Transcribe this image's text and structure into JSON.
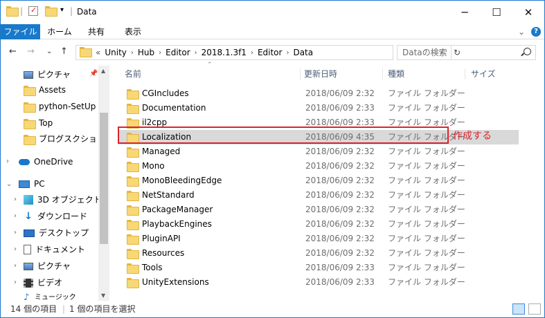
{
  "window": {
    "title": "Data",
    "controls": {
      "minimize": "─",
      "maximize": "☐",
      "close": "✕"
    }
  },
  "ribbon": {
    "tabs": [
      "ファイル",
      "ホーム",
      "共有",
      "表示"
    ],
    "expand_glyph": "⌄",
    "help_glyph": "?"
  },
  "nav_buttons": {
    "back": "←",
    "forward": "→",
    "recent": "⌄",
    "up": "↑"
  },
  "address": {
    "overflow": "«",
    "breadcrumbs": [
      "Unity",
      "Hub",
      "Editor",
      "2018.1.3f1",
      "Editor",
      "Data"
    ],
    "separator": "›",
    "dropdown": "⌄",
    "refresh": "↻"
  },
  "search": {
    "placeholder": "Dataの検索"
  },
  "navpane": {
    "quick_access": [
      "ピクチャ",
      "Assets",
      "python-SetUp",
      "Top",
      "ブログスクショ"
    ],
    "onedrive": "OneDrive",
    "pc": "PC",
    "pc_items": [
      "3D オブジェクト",
      "ダウンロード",
      "デスクトップ",
      "ドキュメント",
      "ピクチャ",
      "ビデオ",
      "ミュージック"
    ],
    "pin": "📌"
  },
  "columns": {
    "name": "名前",
    "date": "更新日時",
    "type": "種類",
    "size": "サイズ"
  },
  "files": [
    {
      "name": "CGIncludes",
      "date": "2018/06/09 2:32",
      "type": "ファイル フォルダー"
    },
    {
      "name": "Documentation",
      "date": "2018/06/09 2:33",
      "type": "ファイル フォルダー"
    },
    {
      "name": "il2cpp",
      "date": "2018/06/09 2:33",
      "type": "ファイル フォルダー"
    },
    {
      "name": "Localization",
      "date": "2018/06/09 4:35",
      "type": "ファイル フォルダー"
    },
    {
      "name": "Managed",
      "date": "2018/06/09 2:32",
      "type": "ファイル フォルダー"
    },
    {
      "name": "Mono",
      "date": "2018/06/09 2:32",
      "type": "ファイル フォルダー"
    },
    {
      "name": "MonoBleedingEdge",
      "date": "2018/06/09 2:32",
      "type": "ファイル フォルダー"
    },
    {
      "name": "NetStandard",
      "date": "2018/06/09 2:32",
      "type": "ファイル フォルダー"
    },
    {
      "name": "PackageManager",
      "date": "2018/06/09 2:32",
      "type": "ファイル フォルダー"
    },
    {
      "name": "PlaybackEngines",
      "date": "2018/06/09 2:32",
      "type": "ファイル フォルダー"
    },
    {
      "name": "PluginAPI",
      "date": "2018/06/09 2:32",
      "type": "ファイル フォルダー"
    },
    {
      "name": "Resources",
      "date": "2018/06/09 2:32",
      "type": "ファイル フォルダー"
    },
    {
      "name": "Tools",
      "date": "2018/06/09 2:33",
      "type": "ファイル フォルダー"
    },
    {
      "name": "UnityExtensions",
      "date": "2018/06/09 2:33",
      "type": "ファイル フォルダー"
    }
  ],
  "selected_file": "Localization",
  "annotation": "作成する",
  "status": {
    "item_count": "14 個の項目",
    "selection": "1 個の項目を選択"
  },
  "colors": {
    "accent": "#1979ca",
    "highlight_border": "#d9242b",
    "selected_row": "#d9d9d9"
  }
}
